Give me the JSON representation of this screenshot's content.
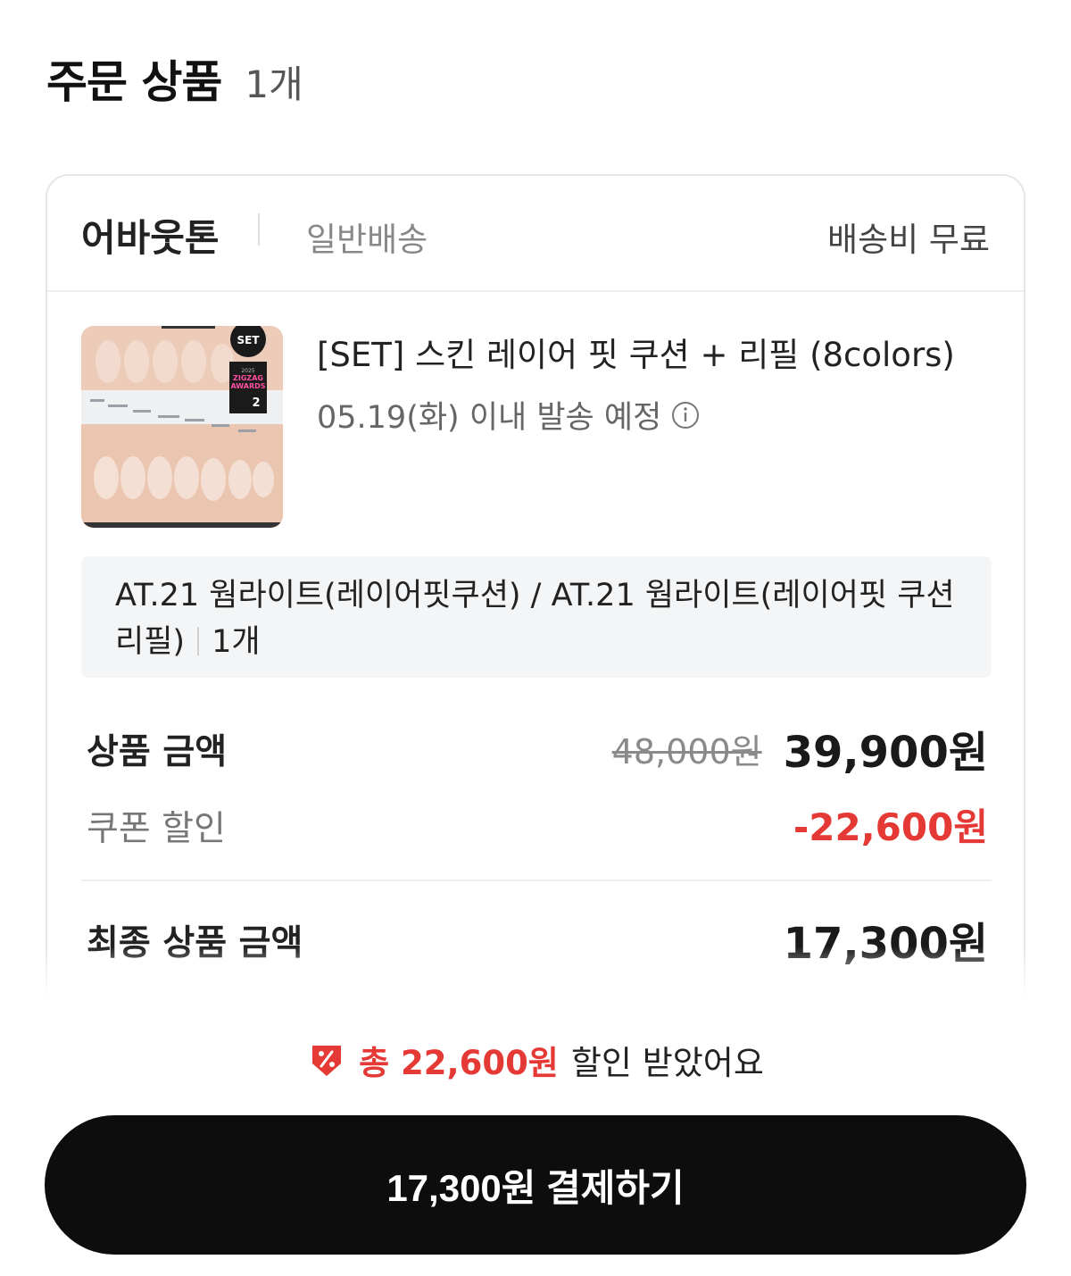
{
  "header": {
    "title": "주문 상품",
    "count": "1개"
  },
  "shop": {
    "name": "어바웃톤",
    "shipping_type": "일반배송",
    "shipping_fee": "배송비 무료"
  },
  "product": {
    "name": "[SET] 스킨 레이어 핏 쿠션 + 리필 (8colors)",
    "ship_date": "05.19(화) 이내 발송 예정",
    "thumbnail_badge": "SET",
    "thumbnail_award": {
      "year": "2025",
      "line1": "ZIGZAG",
      "line2": "AWARDS",
      "rank": "2"
    },
    "option_text": "AT.21 웜라이트(레이어핏쿠션) / AT.21 웜라이트(레이어핏 쿠션리필)",
    "option_qty": "1개"
  },
  "prices": {
    "product_amount_label": "상품 금액",
    "original_price": "48,000원",
    "sale_price": "39,900원",
    "coupon_label": "쿠폰 할인",
    "coupon_value": "-22,600원",
    "final_label": "최종 상품 금액",
    "final_price": "17,300원"
  },
  "summary": {
    "discount_highlight": "총 22,600원",
    "discount_suffix": "할인 받았어요"
  },
  "cta": {
    "pay_label": "17,300원 결제하기"
  },
  "colors": {
    "accent_red": "#e53935",
    "button_black": "#0d0d0d"
  }
}
